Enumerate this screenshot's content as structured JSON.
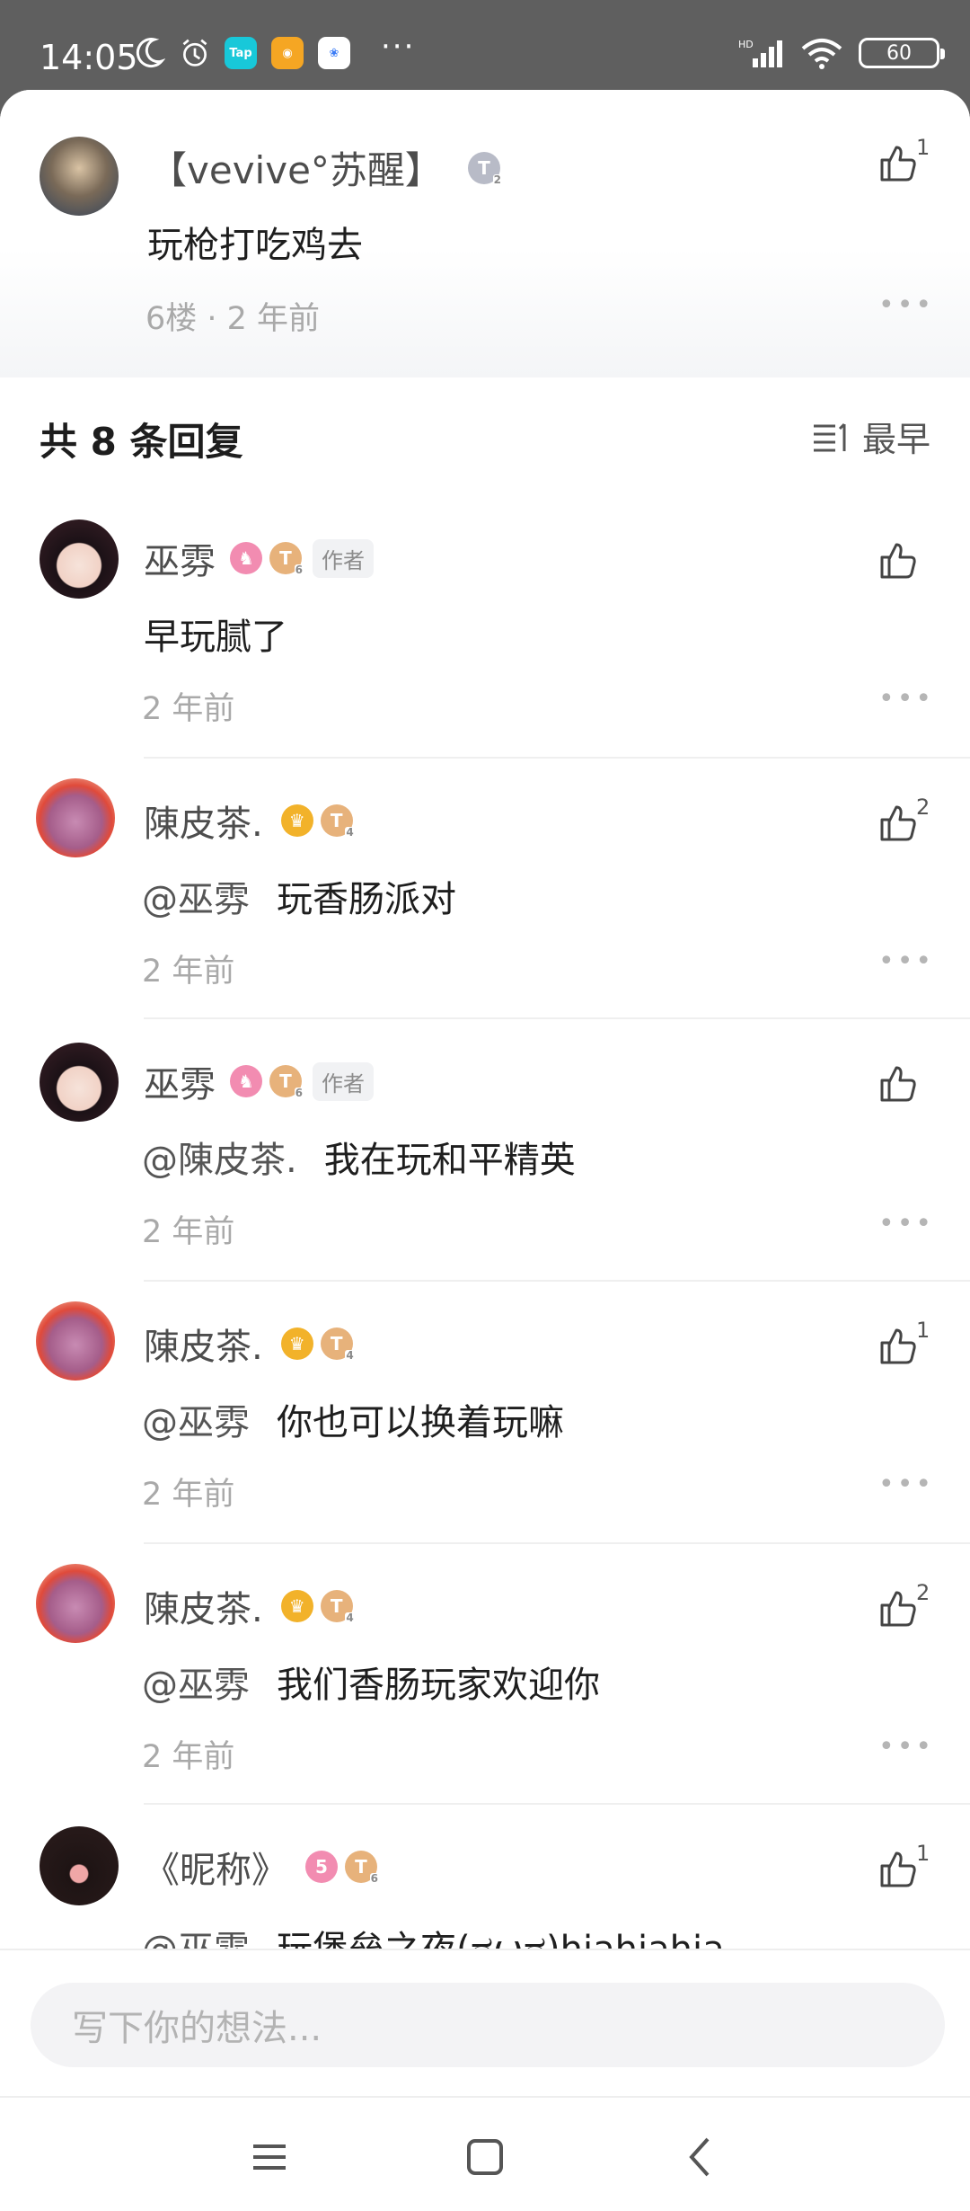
{
  "status": {
    "time": "14:05",
    "battery": "60",
    "more": "···"
  },
  "top_comment": {
    "name": "【vevive°苏醒】",
    "text": "玩枪打吃鸡去",
    "meta": "6楼 · 2 年前",
    "likes": "1"
  },
  "replies_header": {
    "count_label": "共 8 条回复",
    "sort_label": "最早"
  },
  "replies": [
    {
      "name": "巫雰",
      "author_tag": "作者",
      "at": "",
      "text": "早玩腻了",
      "time": "2 年前",
      "likes": ""
    },
    {
      "name": "陳皮茶.",
      "author_tag": "",
      "at": "@巫雰",
      "text": "玩香肠派对",
      "time": "2 年前",
      "likes": "2"
    },
    {
      "name": "巫雰",
      "author_tag": "作者",
      "at": "@陳皮茶.",
      "text": "我在玩和平精英",
      "time": "2 年前",
      "likes": ""
    },
    {
      "name": "陳皮茶.",
      "author_tag": "",
      "at": "@巫雰",
      "text": "你也可以换着玩嘛",
      "time": "2 年前",
      "likes": "1"
    },
    {
      "name": "陳皮茶.",
      "author_tag": "",
      "at": "@巫雰",
      "text": "我们香肠玩家欢迎你",
      "time": "2 年前",
      "likes": "2"
    },
    {
      "name": "《昵称》",
      "author_tag": "",
      "at": "@巫雰",
      "text": "玩堡垒之夜(ಡωಡ)hiahiahia",
      "time": "",
      "likes": "1"
    }
  ],
  "input": {
    "placeholder": "写下你的想法..."
  },
  "badges": {
    "t_letter": "T",
    "level_2": "2",
    "level_4": "4",
    "level_6": "6"
  },
  "colors": {
    "accent": "#e7b27b",
    "meta": "#a9a9a9"
  }
}
